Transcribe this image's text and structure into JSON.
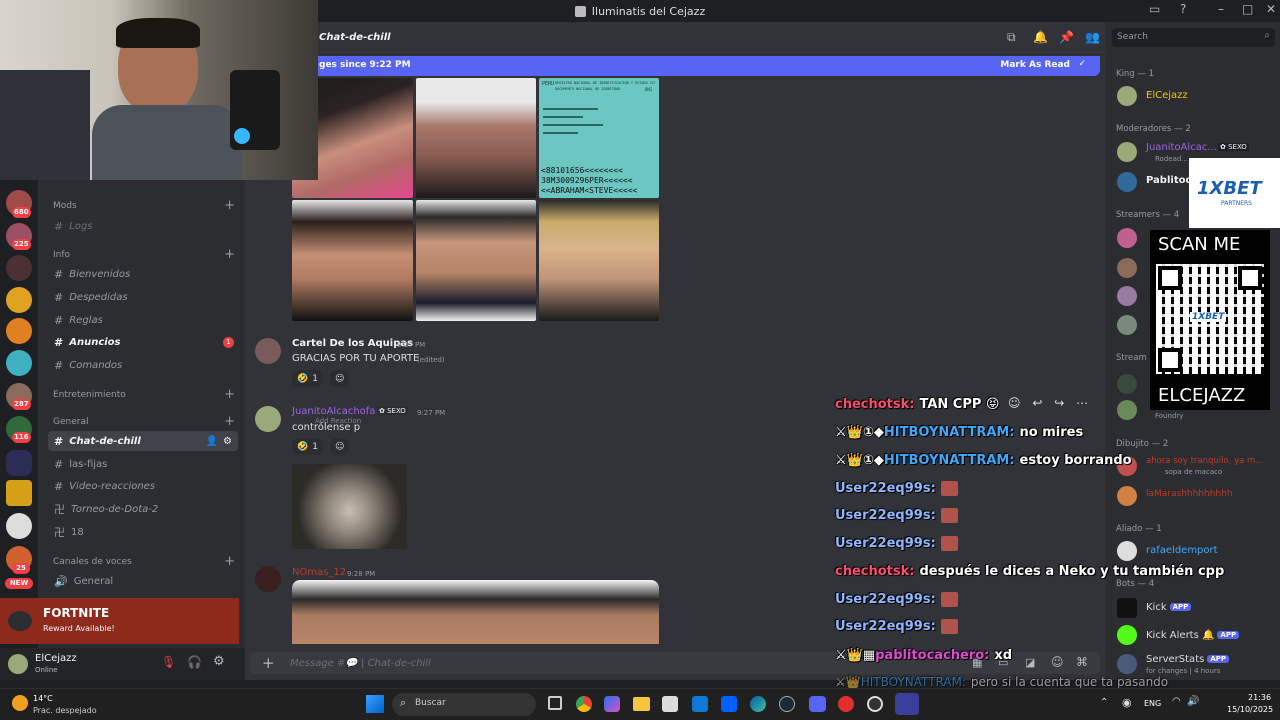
{
  "window": {
    "title": "Iluminatis del Cejazz"
  },
  "chat_header": {
    "channel": "Chat-de-chill",
    "search_placeholder": "Search"
  },
  "new_messages_bar": {
    "text": "ges since 9:22 PM",
    "mark_read": "Mark As Read"
  },
  "server_rail": {
    "badges": [
      "680",
      "225",
      "287",
      "116",
      "25"
    ],
    "new_label": "NEW"
  },
  "channels": {
    "mods_category": "Mods",
    "logs": "Logs",
    "info_category": "Info",
    "bienvenidos": "Bienvenidos",
    "despedidas": "Despedidas",
    "reglas": "Reglas",
    "anuncios": "Anuncios",
    "anuncios_badge": "1",
    "comandos": "Comandos",
    "entretenimiento_category": "Entretenimiento",
    "general_category": "General",
    "chat_de_chill": "Chat-de-chill",
    "las_fijas": "las-fijas",
    "video_reacciones": "Video-reacciones",
    "torneo": "Torneo-de-Dota-2",
    "eighteen": "18",
    "voice_category": "Canales de voces",
    "voice_general": "General"
  },
  "promo": {
    "title": "FORTNITE",
    "subtitle": "Reward Available!"
  },
  "user_panel": {
    "name": "ElCejazz",
    "status": "Online"
  },
  "messages": [
    {
      "author": "Cartel De los Aquipas",
      "time": "9:27 PM",
      "text": "GRACIAS POR TU APORTE",
      "edited": "(edited)",
      "reaction_count": "1"
    },
    {
      "author": "JuanitoAlcachofa",
      "tag": "SEXO",
      "time": "9:27 PM",
      "text": "contrólense p",
      "tooltip": "Add Reaction",
      "reaction_count": "1"
    },
    {
      "author": "NOmas_12",
      "time": "9:28 PM"
    }
  ],
  "id_card_text": [
    "PERU",
    "REGISTRO NACIONAL DE IDENTIFICACION Y ESTADO CIVIL",
    "DOCUMENTO NACIONAL DE IDENTIDAD",
    "DNI",
    "<88101656<<<<<<<<",
    "38M3009296PER<<<<<<",
    "<<ABRAHAM<STEVE<<<<<"
  ],
  "composer": {
    "placeholder": "Message #💬 | Chat-de-chill"
  },
  "members": {
    "king_cat": "King — 1",
    "king": "ElCejazz",
    "mods_cat": "Moderadores — 2",
    "mod1": "JuanitoAlcac...",
    "mod1_tag": "SEXO",
    "mod1_sub": "Rodead...",
    "mod2": "Pablitode",
    "streamers_cat": "Streamers — 4",
    "stream_cat2": "Stream",
    "foundry": "Foundry",
    "dibujito_cat": "Dibujito — 2",
    "dib1": "ahora soy tranquilo, ya m...",
    "dib1_sub": "sopa de macaco",
    "dib2": "laMarashhhhhhhhh",
    "aliado_cat": "Aliado — 1",
    "aliado": "rafaeldemport",
    "bots_cat": "Bots — 4",
    "bot1": "Kick",
    "bot2": "Kick Alerts",
    "bot3": "ServerStats",
    "bot3_sub": "for changes | 4 hours",
    "app_label": "APP"
  },
  "overlay_chat": [
    {
      "user": "chechotsk:",
      "color": "#ff4d6d",
      "text": "TAN CPP"
    },
    {
      "user": "HITBOYNATTRAM:",
      "color": "#3fa9ff",
      "text": "no mires"
    },
    {
      "user": "HITBOYNATTRAM:",
      "color": "#3fa9ff",
      "text": "estoy borrando"
    },
    {
      "user": "User22eq99s:",
      "color": "#8fb7ff",
      "text": ""
    },
    {
      "user": "User22eq99s:",
      "color": "#8fb7ff",
      "text": ""
    },
    {
      "user": "User22eq99s:",
      "color": "#8fb7ff",
      "text": ""
    },
    {
      "user": "chechotsk:",
      "color": "#ff4d6d",
      "text": "después le dices a Neko y tu también cpp"
    },
    {
      "user": "User22eq99s:",
      "color": "#8fb7ff",
      "text": ""
    },
    {
      "user": "User22eq99s:",
      "color": "#8fb7ff",
      "text": ""
    },
    {
      "user": "pablitocachero:",
      "color": "#e04ad1",
      "text": "xd"
    },
    {
      "user": "HITBOYNATTRAM:",
      "color": "#3fa9ff",
      "text": "pero si la cuenta que ta pasando"
    }
  ],
  "sponsor": {
    "brand": "1XBET",
    "partners": "PARTNERS",
    "scan": "SCAN ME",
    "handle": "ELCEJAZZ",
    "qr_brand": "1XBET"
  },
  "taskbar": {
    "weather_temp": "14°C",
    "weather_desc": "Prac. despejado",
    "search_placeholder": "Buscar",
    "lang": "ENG",
    "time": "21:36",
    "date": "15/10/2025"
  },
  "colors": {
    "accent": "#5865f2",
    "danger": "#f23f43",
    "online": "#23a55a",
    "bg": "#313338"
  }
}
